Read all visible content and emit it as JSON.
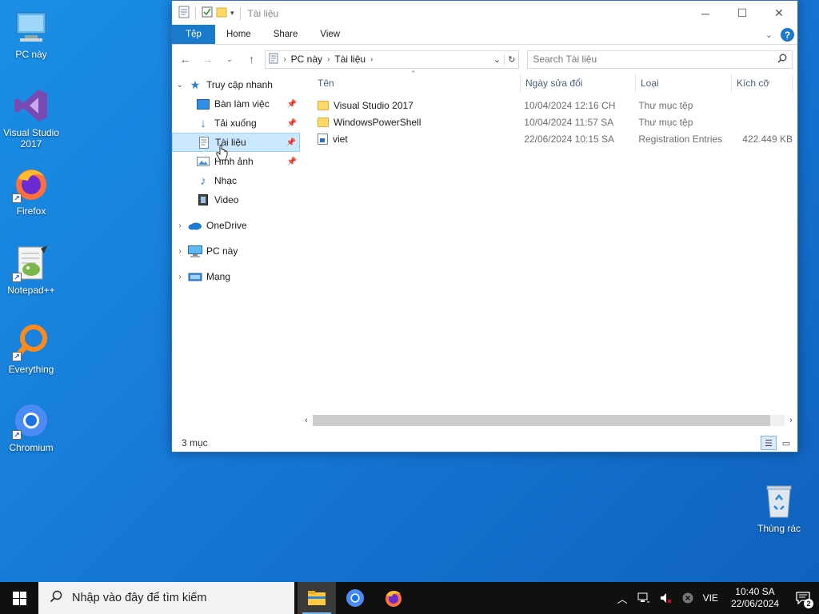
{
  "desktop": {
    "icons": [
      {
        "label": "PC này"
      },
      {
        "label": "Visual Studio 2017"
      },
      {
        "label": "Firefox"
      },
      {
        "label": "Notepad++"
      },
      {
        "label": "Everything"
      },
      {
        "label": "Chromium"
      },
      {
        "label": "Thùng rác"
      }
    ]
  },
  "window": {
    "title": "Tài liệu",
    "controls": {
      "minimize": "─",
      "maximize": "☐",
      "close": "✕"
    },
    "ribbon_tabs": [
      "Tệp",
      "Home",
      "Share",
      "View"
    ],
    "address": {
      "crumbs": [
        "PC này",
        "Tài liệu"
      ]
    },
    "search_placeholder": "Search Tài liệu",
    "nav": {
      "quick_access": "Truy cập nhanh",
      "quick_items": [
        {
          "label": "Bàn làm việc"
        },
        {
          "label": "Tải xuống"
        },
        {
          "label": "Tài liệu"
        },
        {
          "label": "Hình ảnh"
        },
        {
          "label": "Nhạc"
        },
        {
          "label": "Video"
        }
      ],
      "onedrive": "OneDrive",
      "this_pc": "PC này",
      "network": "Mạng"
    },
    "columns": [
      "Tên",
      "Ngày sửa đổi",
      "Loại",
      "Kích cỡ"
    ],
    "files": [
      {
        "name": "Visual Studio 2017",
        "date": "10/04/2024 12:16 CH",
        "type": "Thư mục tệp",
        "size": ""
      },
      {
        "name": "WindowsPowerShell",
        "date": "10/04/2024 11:57 SA",
        "type": "Thư mục tệp",
        "size": ""
      },
      {
        "name": "viet",
        "date": "22/06/2024 10:15 SA",
        "type": "Registration Entries",
        "size": "422.449 KB"
      }
    ],
    "status": "3 mục"
  },
  "taskbar": {
    "search_placeholder": "Nhập vào đây để tìm kiếm",
    "lang": "VIE",
    "time": "10:40 SA",
    "date": "22/06/2024",
    "notifications": "2"
  },
  "colors": {
    "accent": "#1979ca",
    "selection": "#cce8ff",
    "desktop": "#1679d6"
  }
}
